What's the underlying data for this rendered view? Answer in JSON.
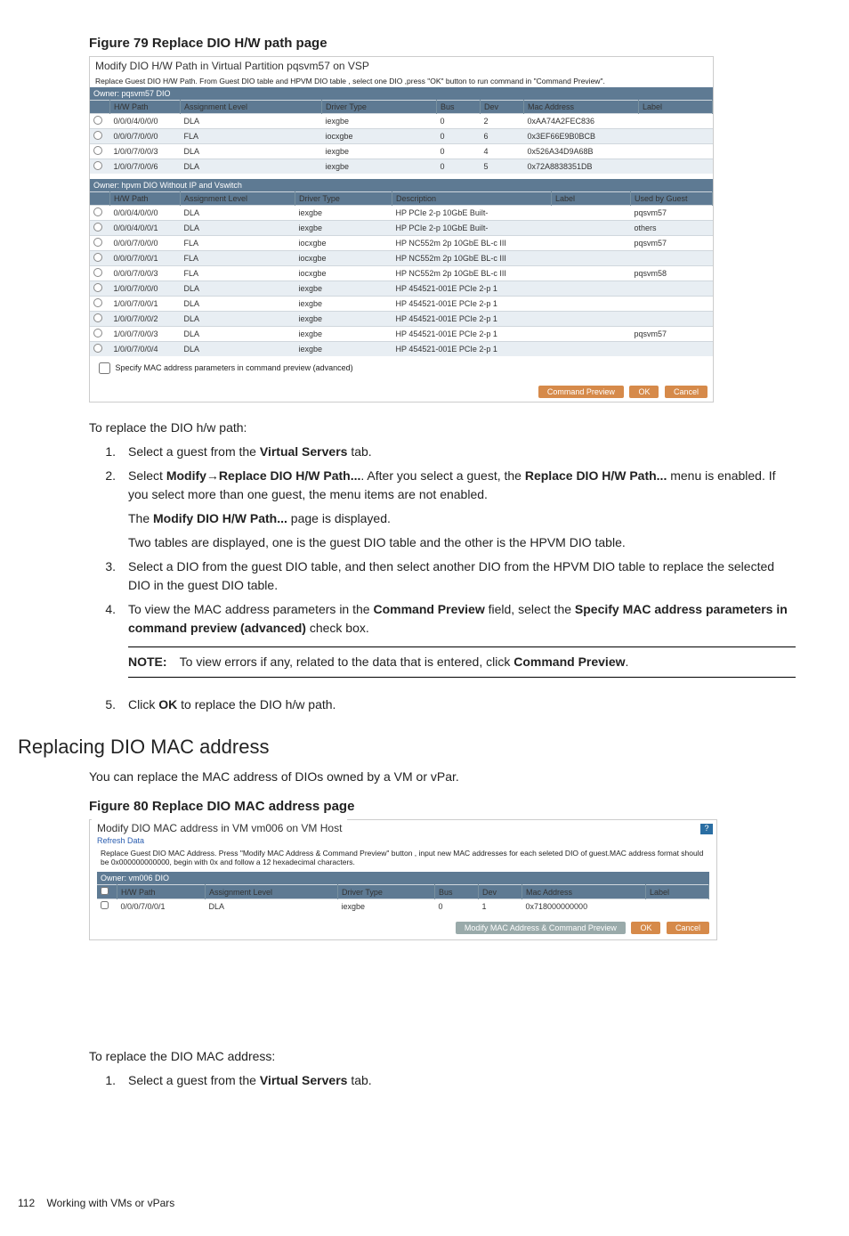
{
  "figure79": {
    "title": "Figure 79 Replace DIO H/W path page",
    "dialog_title": "Modify DIO H/W Path in Virtual Partition pqsvm57 on VSP",
    "instruction": "Replace Guest DIO H/W Path. From Guest DIO table and HPVM DIO table , select one DIO ,press \"OK\" button to run command in \"Command Preview\".",
    "owner_bar1": "Owner: pqsvm57 DIO",
    "headers1": [
      "",
      "H/W Path",
      "Assignment Level",
      "Driver Type",
      "Bus",
      "Dev",
      "Mac Address",
      "Label"
    ],
    "rows1": [
      {
        "hw": "0/0/0/4/0/0/0",
        "al": "DLA",
        "dt": "iexgbe",
        "bus": "0",
        "dev": "2",
        "mac": "0xAA74A2FEC836",
        "lbl": ""
      },
      {
        "hw": "0/0/0/7/0/0/0",
        "al": "FLA",
        "dt": "iocxgbe",
        "bus": "0",
        "dev": "6",
        "mac": "0x3EF66E9B0BCB",
        "lbl": ""
      },
      {
        "hw": "1/0/0/7/0/0/3",
        "al": "DLA",
        "dt": "iexgbe",
        "bus": "0",
        "dev": "4",
        "mac": "0x526A34D9A68B",
        "lbl": ""
      },
      {
        "hw": "1/0/0/7/0/0/6",
        "al": "DLA",
        "dt": "iexgbe",
        "bus": "0",
        "dev": "5",
        "mac": "0x72A8838351DB",
        "lbl": ""
      }
    ],
    "owner_bar2": "Owner: hpvm DIO Without IP and Vswitch",
    "headers2": [
      "",
      "H/W Path",
      "Assignment Level",
      "Driver Type",
      "Description",
      "Label",
      "Used by Guest"
    ],
    "rows2": [
      {
        "hw": "0/0/0/4/0/0/0",
        "al": "DLA",
        "dt": "iexgbe",
        "desc": "HP PCIe 2-p 10GbE Built-",
        "lbl": "",
        "usr": "pqsvm57"
      },
      {
        "hw": "0/0/0/4/0/0/1",
        "al": "DLA",
        "dt": "iexgbe",
        "desc": "HP PCIe 2-p 10GbE Built-",
        "lbl": "",
        "usr": "others"
      },
      {
        "hw": "0/0/0/7/0/0/0",
        "al": "FLA",
        "dt": "iocxgbe",
        "desc": "HP NC552m 2p 10GbE BL-c III",
        "lbl": "",
        "usr": "pqsvm57"
      },
      {
        "hw": "0/0/0/7/0/0/1",
        "al": "FLA",
        "dt": "iocxgbe",
        "desc": "HP NC552m 2p 10GbE BL-c III",
        "lbl": "",
        "usr": ""
      },
      {
        "hw": "0/0/0/7/0/0/3",
        "al": "FLA",
        "dt": "iocxgbe",
        "desc": "HP NC552m 2p 10GbE BL-c III",
        "lbl": "",
        "usr": "pqsvm58"
      },
      {
        "hw": "1/0/0/7/0/0/0",
        "al": "DLA",
        "dt": "iexgbe",
        "desc": "HP 454521-001E PCIe 2-p 1",
        "lbl": "",
        "usr": ""
      },
      {
        "hw": "1/0/0/7/0/0/1",
        "al": "DLA",
        "dt": "iexgbe",
        "desc": "HP 454521-001E PCIe 2-p 1",
        "lbl": "",
        "usr": ""
      },
      {
        "hw": "1/0/0/7/0/0/2",
        "al": "DLA",
        "dt": "iexgbe",
        "desc": "HP 454521-001E PCIe 2-p 1",
        "lbl": "",
        "usr": ""
      },
      {
        "hw": "1/0/0/7/0/0/3",
        "al": "DLA",
        "dt": "iexgbe",
        "desc": "HP 454521-001E PCIe 2-p 1",
        "lbl": "",
        "usr": "pqsvm57"
      },
      {
        "hw": "1/0/0/7/0/0/4",
        "al": "DLA",
        "dt": "iexgbe",
        "desc": "HP 454521-001E PCIe 2-p 1",
        "lbl": "",
        "usr": ""
      }
    ],
    "checkbox_label": "Specify MAC address parameters in command preview (advanced)",
    "btn_preview": "Command Preview",
    "btn_ok": "OK",
    "btn_cancel": "Cancel"
  },
  "body1": {
    "intro": "To replace the DIO h/w path:",
    "step1_a": "Select a guest from the ",
    "step1_b": "Virtual Servers",
    "step1_c": " tab.",
    "step2_a": "Select ",
    "step2_b": "Modify",
    "step2_c": "→",
    "step2_d": "Replace DIO H/W Path...",
    "step2_e": ". After you select a guest, the ",
    "step2_f": "Replace DIO H/W Path...",
    "step2_g": " menu is enabled. If you select more than one guest, the menu items are not enabled.",
    "step2_h": "The ",
    "step2_i": "Modify DIO H/W Path...",
    "step2_j": " page is displayed.",
    "step2_k": "Two tables are displayed, one is the guest DIO table and the other is the HPVM DIO table.",
    "step3": "Select a DIO from the guest DIO table, and then select another DIO from the HPVM DIO table to replace the selected DIO in the guest DIO table.",
    "step4_a": "To view the MAC address parameters in the ",
    "step4_b": "Command Preview",
    "step4_c": " field, select the ",
    "step4_d": "Specify MAC address parameters in command preview (advanced)",
    "step4_e": " check box.",
    "note_lbl": "NOTE:",
    "note_txt_a": "To view errors if any, related to the data that is entered, click ",
    "note_txt_b": "Command Preview",
    "note_txt_c": ".",
    "step5_a": "Click ",
    "step5_b": "OK",
    "step5_c": " to replace the DIO h/w path."
  },
  "section2_title": "Replacing DIO MAC address",
  "section2_intro": "You can replace the MAC address of DIOs owned by a VM or vPar.",
  "figure80": {
    "title": "Figure 80 Replace DIO MAC address page",
    "dialog_title": "Modify DIO MAC address in VM vm006 on VM Host",
    "link": "Refresh Data",
    "instruction": "Replace Guest DIO MAC Address. Press \"Modify MAC Address & Command Preview\" button , input new MAC addresses for each seleted DIO of guest.MAC address format should be 0x000000000000, begin with 0x and follow a 12 hexadecimal characters.",
    "owner_bar": "Owner: vm006 DIO",
    "headers": [
      "",
      "H/W Path",
      "Assignment Level",
      "Driver Type",
      "Bus",
      "Dev",
      "Mac Address",
      "Label"
    ],
    "row": {
      "hw": "0/0/0/7/0/0/1",
      "al": "DLA",
      "dt": "iexgbe",
      "bus": "0",
      "dev": "1",
      "mac": "0x718000000000",
      "lbl": ""
    },
    "btn_mod": "Modify MAC Address & Command Preview",
    "btn_ok": "OK",
    "btn_cancel": "Cancel"
  },
  "body2": {
    "intro": "To replace the DIO MAC address:",
    "step1_a": "Select a guest from the ",
    "step1_b": "Virtual Servers",
    "step1_c": " tab."
  },
  "footer": {
    "page": "112",
    "chapter": "Working with VMs or vPars"
  }
}
